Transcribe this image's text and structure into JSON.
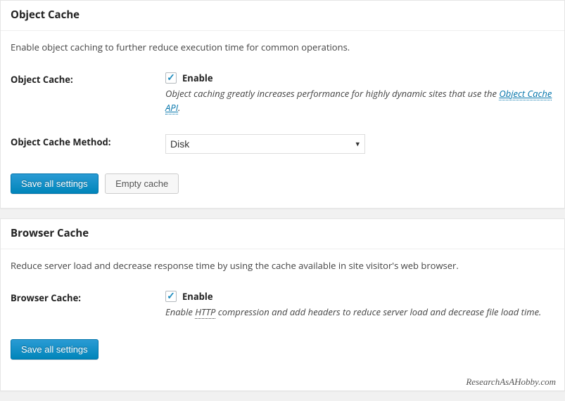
{
  "object_cache": {
    "title": "Object Cache",
    "description": "Enable object caching to further reduce execution time for common operations.",
    "enable_label": "Object Cache:",
    "checkbox_label": "Enable",
    "help_prefix": "Object caching greatly increases performance for highly dynamic sites that use the ",
    "help_link": "Object Cache API",
    "help_suffix": ".",
    "method_label": "Object Cache Method:",
    "method_value": "Disk",
    "save_button": "Save all settings",
    "empty_button": "Empty cache"
  },
  "browser_cache": {
    "title": "Browser Cache",
    "description": "Reduce server load and decrease response time by using the cache available in site visitor's web browser.",
    "enable_label": "Browser Cache:",
    "checkbox_label": "Enable",
    "help_prefix": "Enable ",
    "help_abbr": "HTTP",
    "help_suffix": " compression and add headers to reduce server load and decrease file load time.",
    "save_button": "Save all settings"
  },
  "footer": "ResearchAsAHobby.com"
}
